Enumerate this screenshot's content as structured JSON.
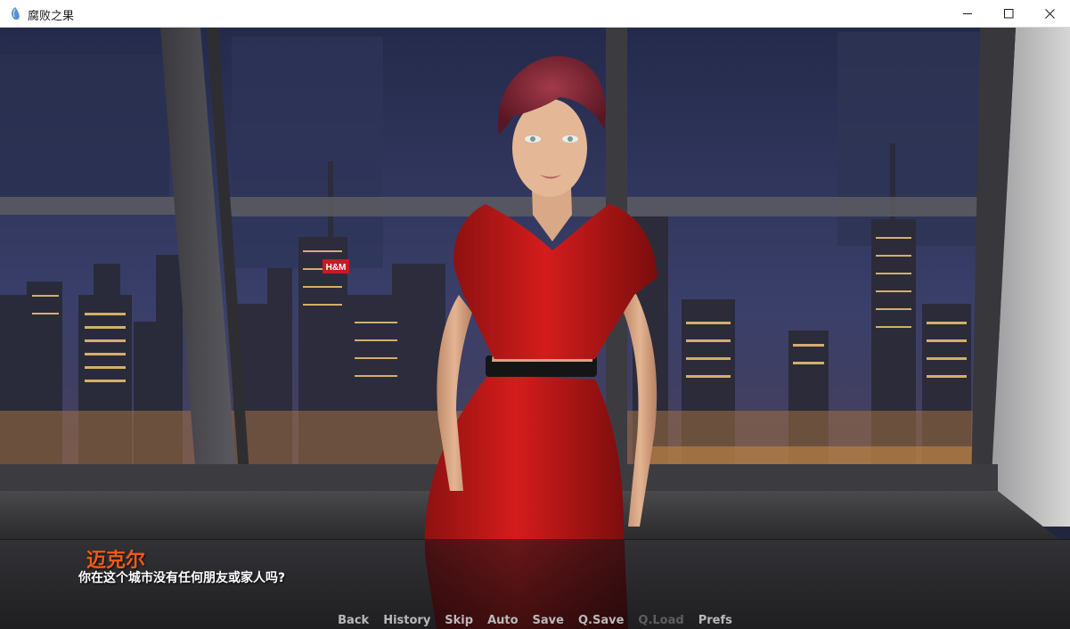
{
  "window": {
    "title": "腐败之果",
    "controls": {
      "minimize_icon": "minimize-icon",
      "maximize_icon": "maximize-icon",
      "close_icon": "close-icon"
    }
  },
  "dialogue": {
    "speaker": "迈克尔",
    "text": "你在这个城市没有任何朋友或家人吗?",
    "speaker_color": "#f05a14"
  },
  "scene": {
    "sign_text": "H&M"
  },
  "quick_menu": {
    "items": [
      {
        "label": "Back",
        "enabled": true
      },
      {
        "label": "History",
        "enabled": true
      },
      {
        "label": "Skip",
        "enabled": true
      },
      {
        "label": "Auto",
        "enabled": true
      },
      {
        "label": "Save",
        "enabled": true
      },
      {
        "label": "Q.Save",
        "enabled": true
      },
      {
        "label": "Q.Load",
        "enabled": false
      },
      {
        "label": "Prefs",
        "enabled": true
      }
    ]
  }
}
